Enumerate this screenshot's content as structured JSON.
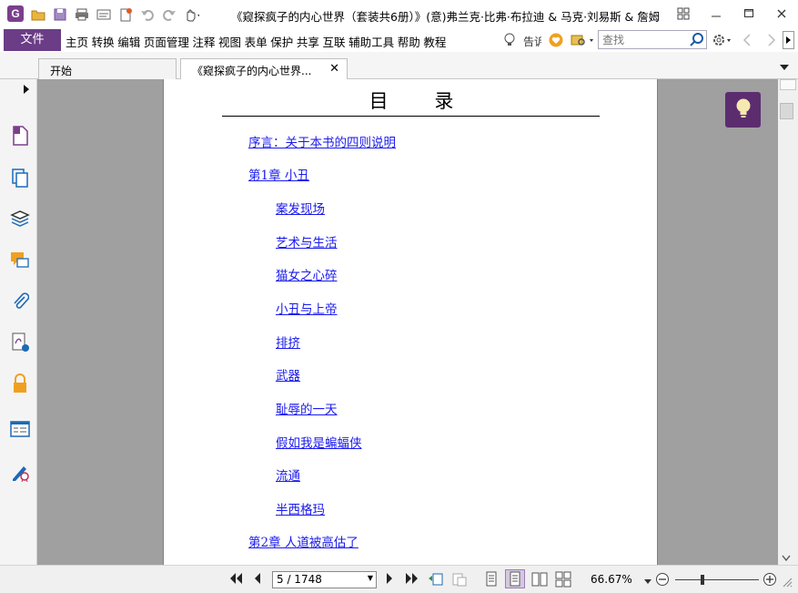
{
  "window": {
    "title": "《窥探疯子的内心世界（套装共6册）》(意)弗兰克·比弗·布拉迪 & 马克·刘易斯 & 詹姆...",
    "controls": [
      "restore-layout",
      "minimize",
      "maximize",
      "close"
    ]
  },
  "menu": {
    "file_label": "文件",
    "items": [
      "主页",
      "转换",
      "编辑",
      "页面管理",
      "注释",
      "视图",
      "表单",
      "保护",
      "共享",
      "互联",
      "辅助工具",
      "帮助",
      "教程"
    ],
    "tell_me_label": "告诉",
    "search_placeholder": "查找"
  },
  "tabs": [
    {
      "label": "开始",
      "active": false
    },
    {
      "label": "《窥探疯子的内心世界...",
      "active": true
    }
  ],
  "toc": {
    "title": "目 录",
    "items": [
      {
        "text": "序言：关于本书的四则说明",
        "level": 1
      },
      {
        "text": "第1章 小丑",
        "level": 1
      },
      {
        "text": "案发现场",
        "level": 2
      },
      {
        "text": "艺术与生活",
        "level": 2
      },
      {
        "text": "猫女之心碎",
        "level": 2
      },
      {
        "text": "小丑与上帝",
        "level": 2
      },
      {
        "text": "排挤",
        "level": 2
      },
      {
        "text": "武器",
        "level": 2
      },
      {
        "text": "耻辱的一天",
        "level": 2
      },
      {
        "text": "假如我是蝙蝠侠",
        "level": 2
      },
      {
        "text": "流通",
        "level": 2
      },
      {
        "text": "半西格玛",
        "level": 2
      },
      {
        "text": "第2章 人道被高估了",
        "level": 1
      }
    ]
  },
  "status": {
    "page_value": "5 / 1748",
    "zoom_label": "66.67%",
    "zoom_level_percent": 66.67
  },
  "colors": {
    "accent": "#6b3d86",
    "link": "#1a1aee",
    "idea_button": "#5c2d6e"
  }
}
